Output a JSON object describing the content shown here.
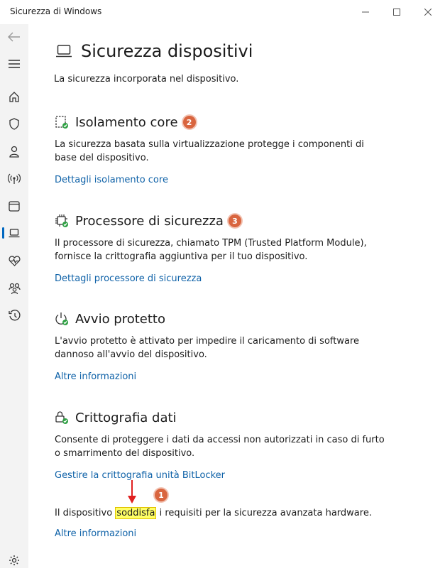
{
  "window": {
    "title": "Sicurezza di Windows",
    "controls": [
      "minimize-icon",
      "maximize-icon",
      "close-icon"
    ]
  },
  "sidebar": {
    "items": [
      {
        "name": "back",
        "icon": "back-arrow-icon"
      },
      {
        "name": "menu",
        "icon": "hamburger-icon"
      },
      {
        "name": "home",
        "icon": "home-icon"
      },
      {
        "name": "virus-protection",
        "icon": "shield-icon"
      },
      {
        "name": "account-protection",
        "icon": "person-icon"
      },
      {
        "name": "firewall-network",
        "icon": "wireless-icon"
      },
      {
        "name": "app-browser-control",
        "icon": "app-window-icon"
      },
      {
        "name": "device-security",
        "icon": "laptop-icon",
        "active": true
      },
      {
        "name": "device-performance",
        "icon": "heart-pulse-icon"
      },
      {
        "name": "family-options",
        "icon": "family-icon"
      },
      {
        "name": "protection-history",
        "icon": "history-icon"
      },
      {
        "name": "settings",
        "icon": "gear-icon"
      }
    ]
  },
  "page": {
    "title": "Sicurezza dispositivi",
    "subtitle": "La sicurezza incorporata nel dispositivo."
  },
  "sections": [
    {
      "title": "Isolamento core",
      "badge": "2",
      "description": "La sicurezza basata sulla virtualizzazione protegge i componenti di base del dispositivo.",
      "link": "Dettagli isolamento core"
    },
    {
      "title": "Processore di sicurezza",
      "badge": "3",
      "description": "Il processore di sicurezza, chiamato TPM (Trusted Platform Module), fornisce la crittografia aggiuntiva per il tuo dispositivo.",
      "link": "Dettagli processore di sicurezza"
    },
    {
      "title": "Avvio protetto",
      "description": "L'avvio protetto è attivato per impedire il caricamento di software dannoso all'avvio del dispositivo.",
      "link": "Altre informazioni"
    },
    {
      "title": "Crittografia dati",
      "description": "Consente di proteggere i dati da accessi non autorizzati in caso di furto o smarrimento del dispositivo.",
      "link": "Gestire la crittografia unità BitLocker"
    }
  ],
  "hardware": {
    "before": "Il dispositivo ",
    "highlight": "soddisfa",
    "after": " i requisiti per la sicurezza avanzata hardware.",
    "badge": "1",
    "link": "Altre informazioni"
  },
  "colors": {
    "accent": "#0067c0",
    "link": "#0f62a8",
    "badge": "#d9653f",
    "highlight": "#ffff66",
    "check": "#2ea043",
    "arrow": "#e02020"
  }
}
